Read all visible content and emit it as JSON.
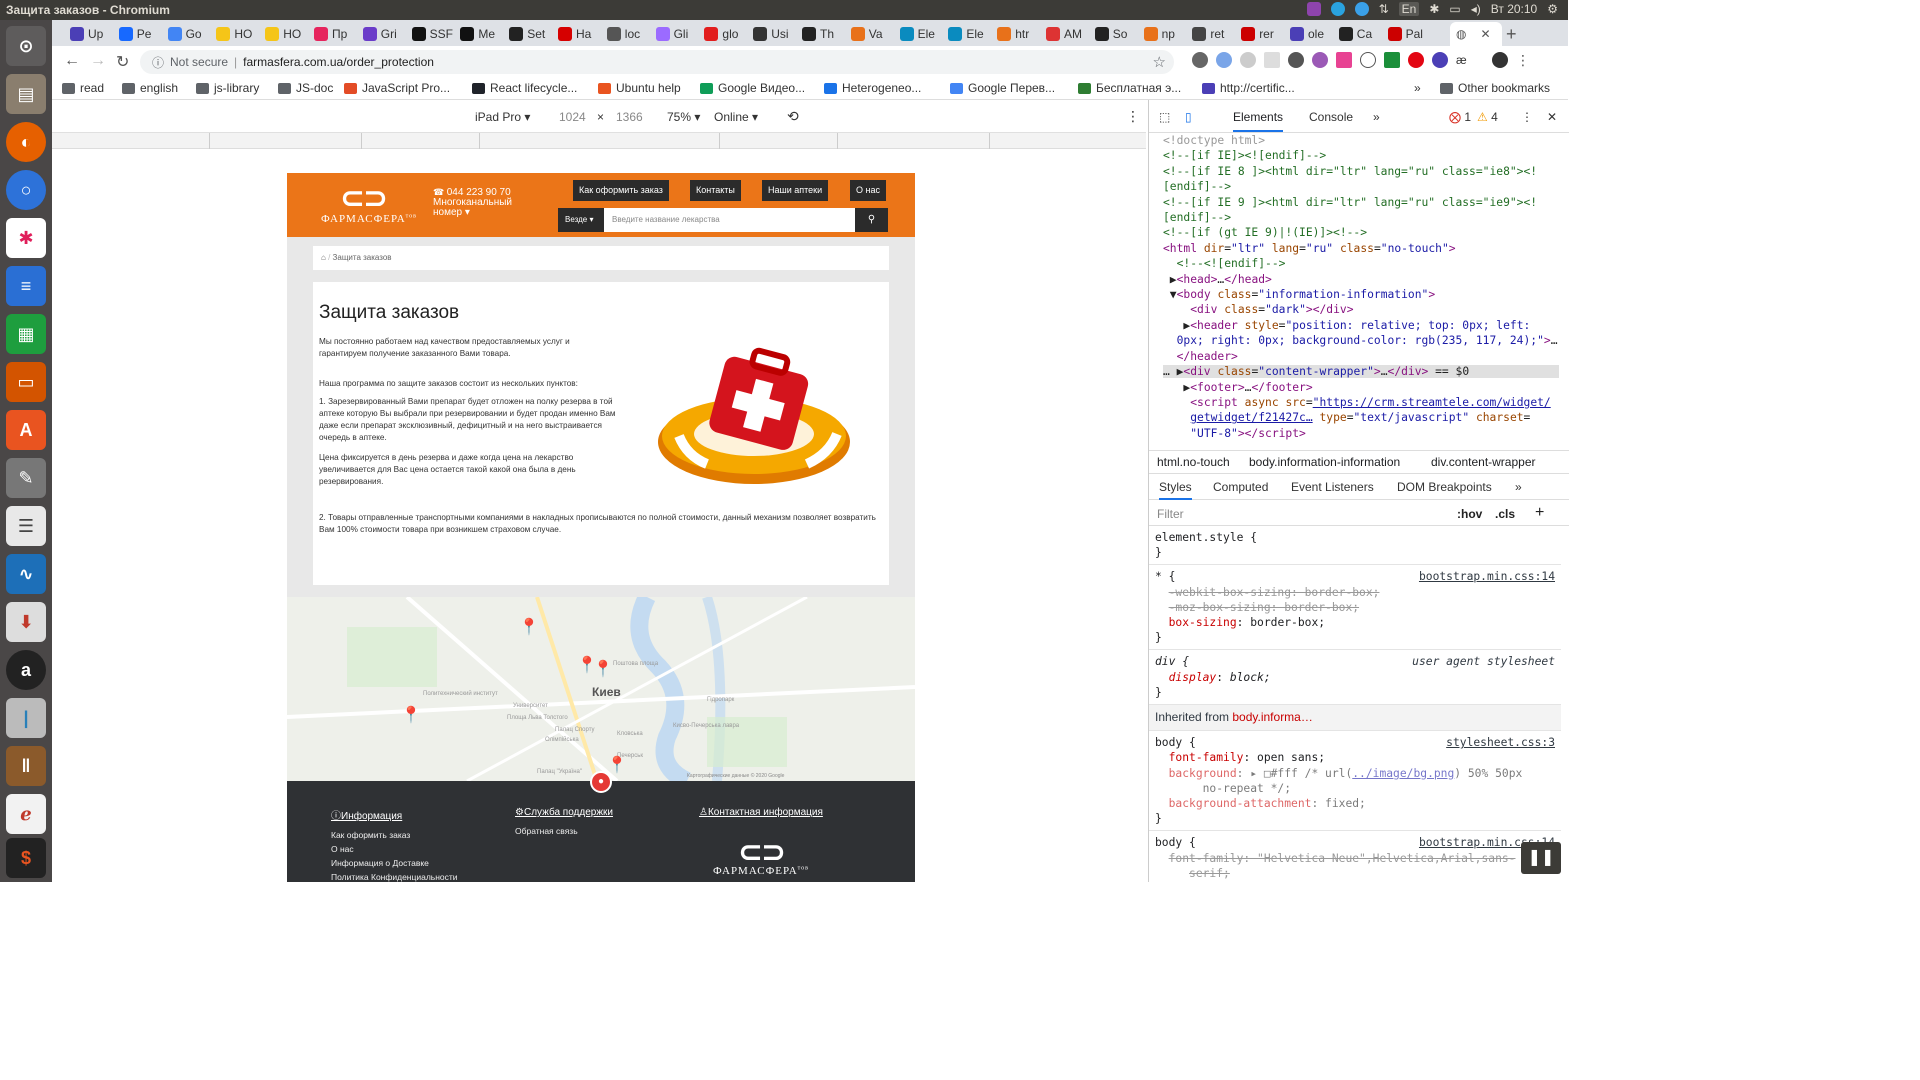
{
  "system": {
    "window_title": "Защита заказов - Chromium",
    "tray": {
      "lang": "En",
      "time": "Вт 20:10"
    }
  },
  "tabs": [
    {
      "label": "Up",
      "color": "#4b3fb6"
    },
    {
      "label": "Pe",
      "color": "#1769ff"
    },
    {
      "label": "Go",
      "color": "#4285f4"
    },
    {
      "label": "HO",
      "color": "#f5c518"
    },
    {
      "label": "HO",
      "color": "#f5c518"
    },
    {
      "label": "Пр",
      "color": "#e6245d"
    },
    {
      "label": "Gri",
      "color": "#6a3cc9"
    },
    {
      "label": "SSF",
      "color": "#111"
    },
    {
      "label": "Me",
      "color": "#111"
    },
    {
      "label": "Set",
      "color": "#222"
    },
    {
      "label": "Ha",
      "color": "#d60000"
    },
    {
      "label": "loc",
      "color": "#555"
    },
    {
      "label": "Gli",
      "color": "#9b6bff"
    },
    {
      "label": "glo",
      "color": "#e21d1d"
    },
    {
      "label": "Usi",
      "color": "#333"
    },
    {
      "label": "Th",
      "color": "#222"
    },
    {
      "label": "Va",
      "color": "#e8711a"
    },
    {
      "label": "Ele",
      "color": "#0a8bbf"
    },
    {
      "label": "Ele",
      "color": "#0a8bbf"
    },
    {
      "label": "htr",
      "color": "#e8711a"
    },
    {
      "label": "AM",
      "color": "#d33"
    },
    {
      "label": "So",
      "color": "#222"
    },
    {
      "label": "np",
      "color": "#e8711a"
    },
    {
      "label": "ret",
      "color": "#444"
    },
    {
      "label": "rer",
      "color": "#c00"
    },
    {
      "label": "ole",
      "color": "#4b3fb6"
    },
    {
      "label": "Ca",
      "color": "#222"
    },
    {
      "label": "Pal",
      "color": "#c00"
    }
  ],
  "active_tab": {
    "label": "",
    "close": "✕"
  },
  "address": {
    "not_secure": "Not secure",
    "url": "farmasfera.com.ua/order_protection"
  },
  "bookmarks": [
    {
      "label": "read",
      "color": "#5f6368"
    },
    {
      "label": "english",
      "color": "#5f6368"
    },
    {
      "label": "js-library",
      "color": "#5f6368"
    },
    {
      "label": "JS-doc",
      "color": "#5f6368"
    },
    {
      "label": "JavaScript Pro...",
      "color": "#e34c26"
    },
    {
      "label": "React lifecycle...",
      "color": "#20232a"
    },
    {
      "label": "Ubuntu help",
      "color": "#e95420"
    },
    {
      "label": "Google Видео...",
      "color": "#0f9d58"
    },
    {
      "label": "Heterogeneo...",
      "color": "#1a73e8"
    },
    {
      "label": "Google Перев...",
      "color": "#4285f4"
    },
    {
      "label": "Бесплатная э...",
      "color": "#2e7d32"
    },
    {
      "label": "http://certific...",
      "color": "#4b3fb6"
    }
  ],
  "bookmarks_other": "Other bookmarks",
  "device_toolbar": {
    "device": "iPad Pro",
    "width": "1024",
    "x": "×",
    "height": "1366",
    "zoom": "75%",
    "network": "Online"
  },
  "site": {
    "logo": "ФАРМАСФЕРА",
    "logo_suffix": "тов",
    "phone": "044 223 90 70",
    "phone_note": "Многоканальный",
    "phone_note2": "номер ▾",
    "nav": [
      "Как оформить заказ",
      "Контакты",
      "Наши аптеки",
      "О нас"
    ],
    "search_scope": "Везде ▾",
    "search_placeholder": "Введите название лекарства",
    "breadcrumb": "Защита заказов",
    "title": "Защита заказов",
    "p1": "Мы постоянно работаем над качеством предоставляемых услуг и гарантируем получение заказанного Вами товара.",
    "p2": "Наша программа по защите заказов состоит из нескольких пунктов:",
    "p3": " 1. Зарезервированный Вами препарат будет отложен на полку резерва в той аптеке которую Вы выбрали при резервировании и будет продан именно Вам даже если препарат эксклюзивный, дефицитный и на него выстраивается очередь в аптеке.",
    "p4": "Цена фиксируется в день резерва и даже когда цена на лекарство увеличивается для Вас цена остается такой какой она была в день резервирования.",
    "p5": " 2. Товары отправленные транспортными компаниями в накладных прописываются по полной стоимости, данный механизм позволяет возвратить Вам 100% стоимости товара при возникшем страховом случае.",
    "map": {
      "city": "Киев",
      "labels": [
        "Политехнический институт",
        "Университет",
        "Площа Льва Толстого",
        "Палац Спорту",
        "Олімпійська",
        "Кловська",
        "Лукьяновка",
        "Печерськ",
        "Палац \"Україна\"",
        "Кисво-Печерська лавра",
        "Гідропарк",
        "Поштова площа",
        "Картографические данные © 2020 Google"
      ]
    },
    "footer": {
      "info_title": "Информация",
      "info_links": [
        "Как оформить заказ",
        "О нас",
        "Информация о Доставке",
        "Политика Конфиденциальности"
      ],
      "support_title": "Служба поддержки",
      "support_links": [
        "Обратная связь"
      ],
      "contact_title": "Контактная информация"
    }
  },
  "devtools": {
    "tabs": [
      "Elements",
      "Console"
    ],
    "errors": "1",
    "warnings": "4",
    "breadcrumbs": [
      "html.no-touch",
      "body.information-information",
      "div.content-wrapper"
    ],
    "style_tabs": [
      "Styles",
      "Computed",
      "Event Listeners",
      "DOM Breakpoints"
    ],
    "filter_placeholder": "Filter",
    "hov": ":hov",
    "cls": ".cls",
    "inherited": "Inherited from ",
    "inherited_from": "body.informa…"
  }
}
